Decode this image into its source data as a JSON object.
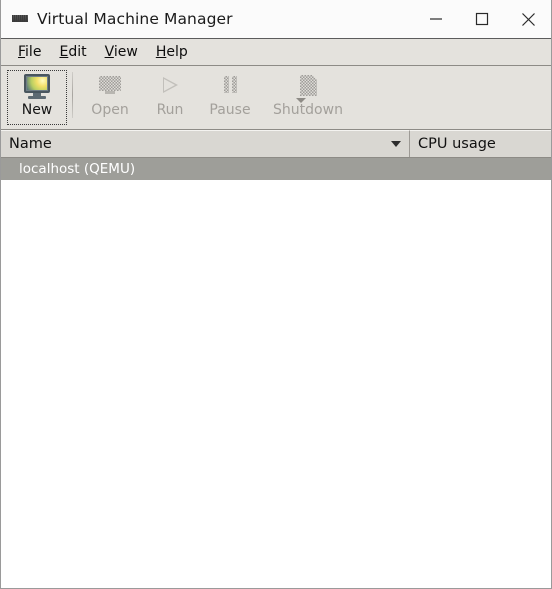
{
  "window": {
    "title": "Virtual Machine Manager",
    "icon": "vmm-logo-icon",
    "controls": {
      "minimize": "minimize-icon",
      "maximize": "maximize-icon",
      "close": "close-icon"
    }
  },
  "menubar": {
    "items": [
      {
        "label": "File",
        "mnemonic": "F",
        "rest": "ile"
      },
      {
        "label": "Edit",
        "mnemonic": "E",
        "rest": "dit"
      },
      {
        "label": "View",
        "mnemonic": "V",
        "rest": "iew"
      },
      {
        "label": "Help",
        "mnemonic": "H",
        "rest": "elp"
      }
    ]
  },
  "toolbar": {
    "items": [
      {
        "label": "New",
        "icon": "new-vm-monitor-icon",
        "enabled": true,
        "focused": true
      },
      {
        "label": "Open",
        "icon": "open-monitor-icon",
        "enabled": false,
        "focused": false
      },
      {
        "label": "Run",
        "icon": "run-play-icon",
        "enabled": false,
        "focused": false
      },
      {
        "label": "Pause",
        "icon": "pause-icon",
        "enabled": false,
        "focused": false
      },
      {
        "label": "Shutdown",
        "icon": "shutdown-icon",
        "enabled": false,
        "focused": false
      }
    ],
    "overflow": "toolbar-overflow-arrow-icon"
  },
  "list": {
    "columns": [
      {
        "label": "Name",
        "sorted": true,
        "sort_direction": "descending"
      },
      {
        "label": "CPU usage",
        "sorted": false,
        "sort_direction": ""
      }
    ],
    "rows": [
      {
        "name": "localhost (QEMU)",
        "cpu_usage": "",
        "selected": true
      }
    ]
  },
  "colors": {
    "chrome": "#e4e2dd",
    "titlebar": "#fbfbfb",
    "header": "#d9d7d2",
    "selection": "#9e9e99",
    "selection_text": "#ffffff",
    "body": "#ffffff"
  }
}
